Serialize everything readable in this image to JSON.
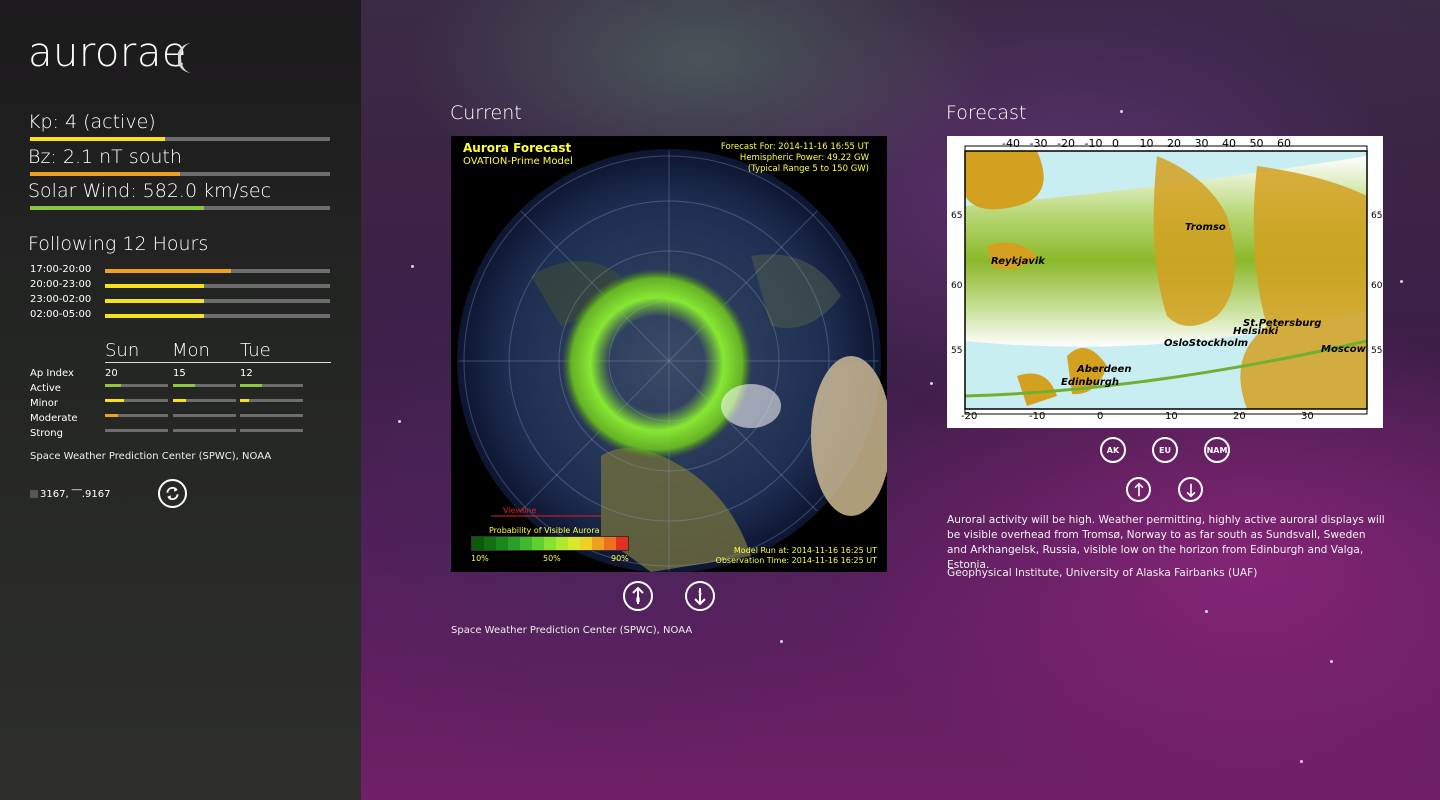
{
  "app": {
    "title": "aurorae"
  },
  "metrics": {
    "kp": {
      "label": "Kp: 4 (active)",
      "level": 0.45,
      "color": "#f5e21c"
    },
    "bz": {
      "label": "Bz: 2.1 nT south",
      "level": 0.5,
      "color": "#f0a020"
    },
    "wind": {
      "label": "Solar Wind: 582.0 km/sec",
      "level": 0.58,
      "color": "#8cc63f"
    }
  },
  "hours": {
    "title": "Following 12 Hours",
    "rows": [
      {
        "time": "17:00-20:00",
        "level": 0.56,
        "color": "#f0a020"
      },
      {
        "time": "20:00-23:00",
        "level": 0.44,
        "color": "#f5e21c"
      },
      {
        "time": "23:00-02:00",
        "level": 0.44,
        "color": "#f5e21c"
      },
      {
        "time": "02:00-05:00",
        "level": 0.44,
        "color": "#f5e21c"
      }
    ]
  },
  "outlook": {
    "days": [
      "Sun",
      "Mon",
      "Tue"
    ],
    "ap_label": "Ap Index",
    "ap_values": [
      "20",
      "15",
      "12"
    ],
    "levels": [
      {
        "label": "Active",
        "values": [
          0.25,
          0.35,
          0.35
        ],
        "color": "#8cc63f"
      },
      {
        "label": "Minor",
        "values": [
          0.3,
          0.2,
          0.15
        ],
        "color": "#f5e21c"
      },
      {
        "label": "Moderate",
        "values": [
          0.2,
          0,
          0
        ],
        "color": "#f0a020"
      },
      {
        "label": "Strong",
        "values": [
          0,
          0,
          0
        ],
        "color": "#e03030"
      }
    ]
  },
  "left_source": "Space Weather Prediction Center (SPWC), NOAA",
  "location": {
    "coords": "3167, ‾‾.9167"
  },
  "current": {
    "title": "Current",
    "image": {
      "heading": "Aurora Forecast",
      "model": "OVATION-Prime Model",
      "forecast_for": "Forecast For: 2014-11-16 16:55 UT",
      "hemi_power": "Hemispheric Power: 49.22 GW",
      "typical": "(Typical Range 5 to 150 GW)",
      "viewline": "Viewline",
      "prob_label": "Probability of Visible Aurora",
      "scale": [
        "10%",
        "50%",
        "90%"
      ],
      "model_run": "Model Run at: 2014-11-16 16:25 UT",
      "obs_time": "Observation Time: 2014-11-16 16:25 UT"
    },
    "source": "Space Weather Prediction Center (SPWC), NOAA"
  },
  "forecast": {
    "title": "Forecast",
    "map": {
      "top_ticks": [
        "-40",
        "-30",
        "-20",
        "-10",
        "0",
        "10",
        "20",
        "30",
        "40",
        "50",
        "60"
      ],
      "bottom_ticks": [
        "-20",
        "-10",
        "0",
        "10",
        "20",
        "30"
      ],
      "lat_ticks": [
        "65",
        "60",
        "55"
      ],
      "cities": [
        "Tromso",
        "Reykjavik",
        "St.Petersburg",
        "Helsinki",
        "OsloStockholm",
        "Aberdeen",
        "Edinburgh",
        "Moscow"
      ]
    },
    "region_buttons": [
      "AK",
      "EU",
      "NAM"
    ],
    "description": "Auroral activity will be high.  Weather permitting, highly active auroral displays will be visible overhead from Tromsø, Norway to as far south as Sundsvall, Sweden and Arkhangelsk, Russia, visible low on the horizon from Edinburgh and Valga, Estonia.",
    "source": "Geophysical Institute, University of Alaska Fairbanks (UAF)"
  }
}
